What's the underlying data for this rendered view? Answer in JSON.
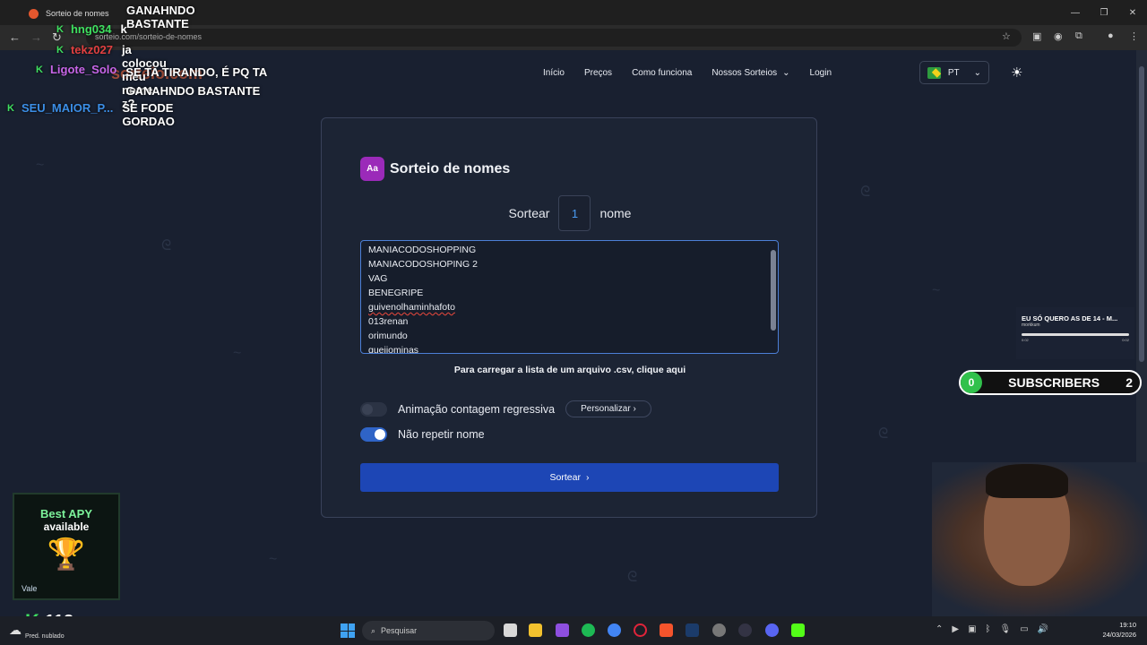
{
  "browser": {
    "tab_title": "Sorteio de nomes",
    "url": "sorteio.com/sorteio-de-nomes",
    "window_buttons": [
      "—",
      "❐",
      "✕"
    ]
  },
  "site": {
    "logo": "sorteio.com",
    "nav": [
      "Início",
      "Preços",
      "Como funciona",
      "Nossos Sorteios",
      "Login"
    ],
    "lang": "PT"
  },
  "card": {
    "title": "Sorteio de nomes",
    "icon_text": "Aa",
    "sort_prefix": "Sortear",
    "quantity": "1",
    "sort_suffix": "nome",
    "names": [
      {
        "text": "MANIACODOSHOPPING",
        "spell": false
      },
      {
        "text": "MANIACODOSHOPING 2",
        "spell": false
      },
      {
        "text": "VAG",
        "spell": false
      },
      {
        "text": "BENEGRIPE",
        "spell": false
      },
      {
        "text": "guivenolhaminhafoto",
        "spell": true
      },
      {
        "text": "013renan",
        "spell": false
      },
      {
        "text": "orimundo",
        "spell": false
      },
      {
        "text": "queijominas",
        "spell": true
      }
    ],
    "csv_text": "Para carregar a lista de um arquivo .csv, clique aqui",
    "toggle1_label": "Animação contagem regressiva",
    "toggle1_on": false,
    "personalizar": "Personalizar",
    "toggle2_label": "Não repetir nome",
    "toggle2_on": true,
    "button": "Sortear"
  },
  "chat": [
    {
      "user": "",
      "text": "GANAHNDO BASTANTE",
      "color": "#ffffff"
    },
    {
      "user": "hng034",
      "text": "k",
      "color": "#3fe060"
    },
    {
      "user": "tekz027",
      "text": "ja colocou meu nome z?",
      "color": "#e04040"
    },
    {
      "user": "Ligote_Solo",
      "text": "SE TA TIRANDO, É PQ TA GANAHNDO BASTANTE",
      "color": "#c765e8"
    },
    {
      "user": "SEU_MAIOR_P...",
      "text": "SE FODE GORDAO",
      "color": "#3b8ee6"
    }
  ],
  "music": {
    "title": "EU SÓ QUERO AS DE 14 - M...",
    "artist": "morkkum",
    "start": "0:02",
    "end": "0:02"
  },
  "subs": {
    "count": "0",
    "label": "SUBSCRIBERS",
    "goal": "2"
  },
  "ad": {
    "line1": "Best APY",
    "line2": "available",
    "brand": "Vale"
  },
  "viewers": "113",
  "taskbar": {
    "weather": "Pred. nublado",
    "search": "Pesquisar",
    "time": "19:10",
    "date": "24/03/2026"
  },
  "colors": {
    "accent": "#1d46b5",
    "icon_bg": "#9b2ab9",
    "kick_green": "#3fe060"
  }
}
